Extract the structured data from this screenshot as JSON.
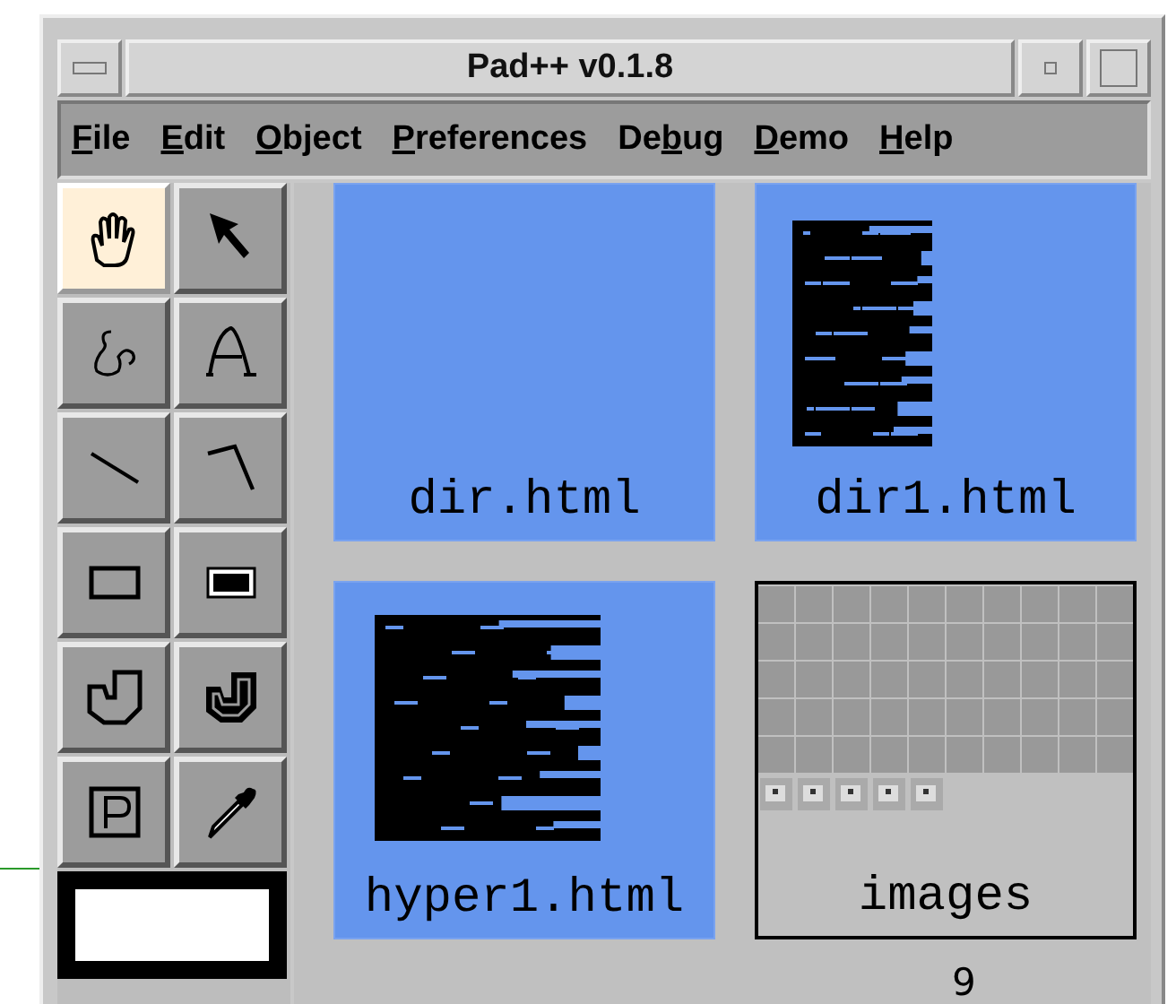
{
  "window": {
    "title": "Pad++ v0.1.8"
  },
  "menu": [
    {
      "mnemonic": "F",
      "after": "ile"
    },
    {
      "mnemonic": "E",
      "after": "dit"
    },
    {
      "mnemonic": "O",
      "after": "bject"
    },
    {
      "mnemonic": "P",
      "after": "references"
    },
    {
      "before": "De",
      "mnemonic": "b",
      "after": "ug"
    },
    {
      "mnemonic": "D",
      "after": "emo"
    },
    {
      "mnemonic": "H",
      "after": "elp"
    }
  ],
  "tools": [
    {
      "kind": "hand",
      "selected": true
    },
    {
      "kind": "arrow",
      "selected": false
    },
    {
      "kind": "freehand",
      "selected": false
    },
    {
      "kind": "text",
      "selected": false
    },
    {
      "kind": "line",
      "selected": false
    },
    {
      "kind": "polyline",
      "selected": false
    },
    {
      "kind": "rectangle",
      "selected": false
    },
    {
      "kind": "filled-rectangle",
      "selected": false
    },
    {
      "kind": "polygon",
      "selected": false
    },
    {
      "kind": "filled-polygon",
      "selected": false
    },
    {
      "kind": "portal",
      "selected": false
    },
    {
      "kind": "eyedropper",
      "selected": false
    }
  ],
  "tiles": [
    {
      "kind": "empty",
      "label": "dir.html"
    },
    {
      "kind": "narrow-page",
      "label": "dir1.html"
    },
    {
      "kind": "wide-page",
      "label": "hyper1.html"
    },
    {
      "kind": "image-folder",
      "label": "images"
    }
  ],
  "overlay_text": "9"
}
